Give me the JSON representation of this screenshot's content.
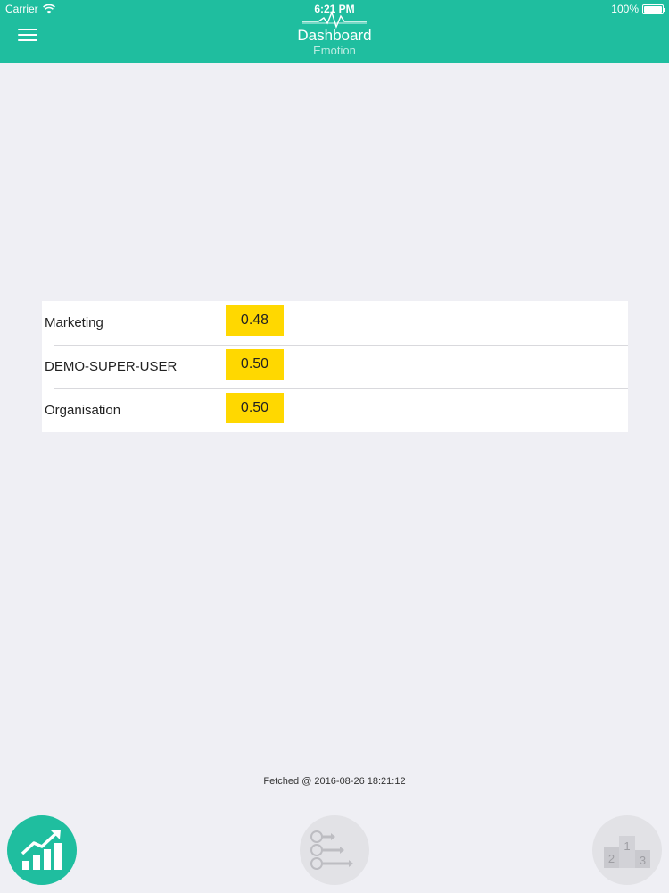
{
  "status_bar": {
    "carrier": "Carrier",
    "time": "6:21 PM",
    "battery": "100%"
  },
  "nav": {
    "title": "Dashboard",
    "subtitle": "Emotion"
  },
  "scores": [
    {
      "label": "Marketing",
      "value": "0.48"
    },
    {
      "label": "DEMO-SUPER-USER",
      "value": "0.50"
    },
    {
      "label": "Organisation",
      "value": "0.50"
    }
  ],
  "footer": {
    "fetched": "Fetched @ 2016-08-26 18:21:12"
  },
  "tabs": {
    "podium_labels": [
      "2",
      "1",
      "3"
    ]
  },
  "colors": {
    "brand": "#1fbe9f",
    "badge": "#ffd800",
    "background": "#efeff4",
    "inactive_tab": "#e2e2e6"
  },
  "icons": [
    "wifi-icon",
    "battery-icon",
    "menu-icon",
    "pulse-logo-icon",
    "trend-chart-icon",
    "ranked-list-icon",
    "podium-icon"
  ]
}
